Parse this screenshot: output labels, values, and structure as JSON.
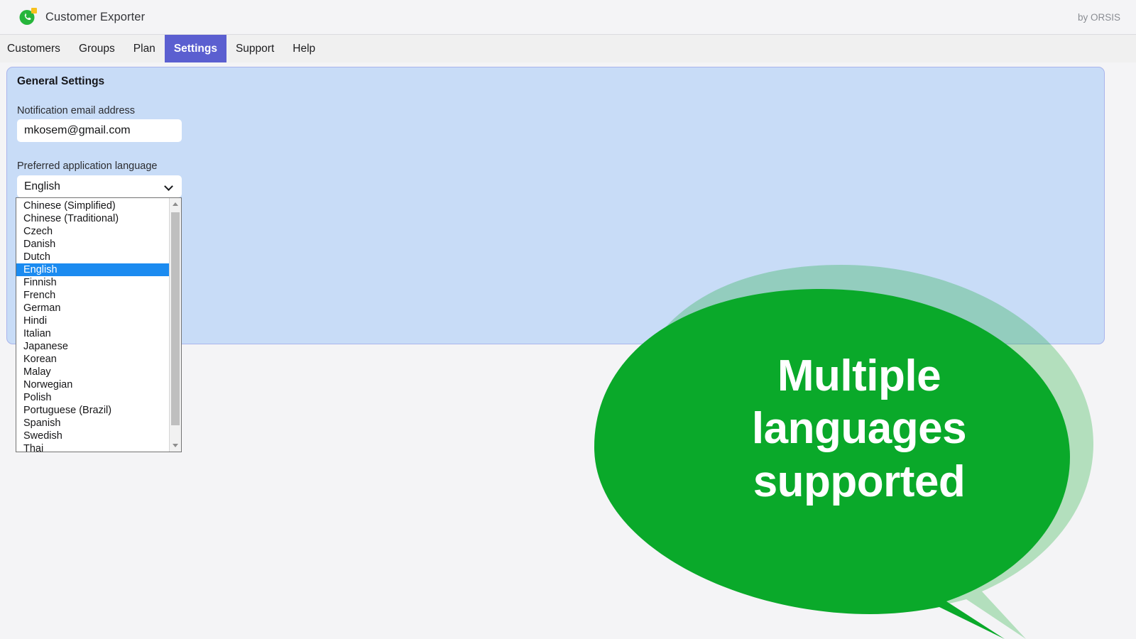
{
  "header": {
    "app_title": "Customer Exporter",
    "logo_icon": "whatsapp-green-phone-icon",
    "byline": "by ORSIS"
  },
  "menu": {
    "items": [
      {
        "label": "Customers",
        "active": false
      },
      {
        "label": "Groups",
        "active": false
      },
      {
        "label": "Plan",
        "active": false
      },
      {
        "label": "Settings",
        "active": true
      },
      {
        "label": "Support",
        "active": false
      },
      {
        "label": "Help",
        "active": false
      }
    ]
  },
  "settings_panel": {
    "title": "General Settings",
    "email_field": {
      "label": "Notification email address",
      "value": "mkosem@gmail.com",
      "placeholder": "Notification email address"
    },
    "language_field": {
      "label": "Preferred application language",
      "selected": "English",
      "chevron_icon": "chevron-down-icon",
      "options": [
        "Chinese (Simplified)",
        "Chinese (Traditional)",
        "Czech",
        "Danish",
        "Dutch",
        "English",
        "Finnish",
        "French",
        "German",
        "Hindi",
        "Italian",
        "Japanese",
        "Korean",
        "Malay",
        "Norwegian",
        "Polish",
        "Portuguese (Brazil)",
        "Spanish",
        "Swedish",
        "Thai"
      ],
      "selected_index": 5
    },
    "scrollbar": {
      "up_arrow_icon": "scroll-up-arrow-icon",
      "down_arrow_icon": "scroll-down-arrow-icon"
    }
  },
  "callout": {
    "text_line1": "Multiple",
    "text_line2": "languages",
    "text_line3": "supported",
    "full_text": "Multiple languages supported"
  },
  "colors": {
    "accent_menu_active": "#5b5fd0",
    "panel_background": "#c8dcf7",
    "panel_border": "#a9b4ec",
    "page_background": "#f4f4f6",
    "option_selected": "#1b8bf0",
    "brand_green": "#0aa92a",
    "bubble_glow": "#0aa92a",
    "logo_badge": "#f7c11e"
  }
}
